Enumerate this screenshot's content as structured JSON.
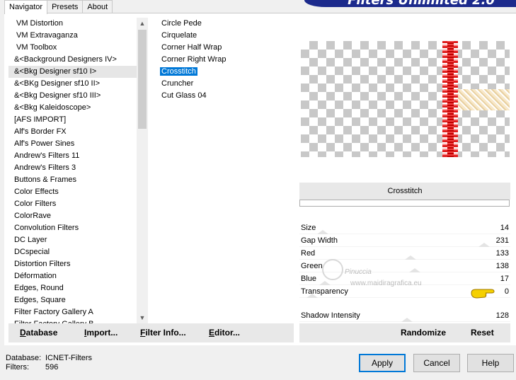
{
  "tabs": [
    {
      "label": "Navigator"
    },
    {
      "label": "Presets"
    },
    {
      "label": "About"
    }
  ],
  "title_banner": "Filters Unlimited 2.0",
  "categories": [
    "VM Distortion",
    "VM Extravaganza",
    "VM Toolbox",
    "&<Background Designers IV>",
    "&<Bkg Designer sf10 I>",
    "&<BKg Designer sf10 II>",
    "&<Bkg Designer sf10 III>",
    "&<Bkg Kaleidoscope>",
    "[AFS IMPORT]",
    "Alf's Border FX",
    "Alf's Power Sines",
    "Andrew's Filters 11",
    "Andrew's Filters 3",
    "Buttons & Frames",
    "Color Effects",
    "Color Filters",
    "ColorRave",
    "Convolution Filters",
    "DC Layer",
    "DCspecial",
    "Distortion Filters",
    "Déformation",
    "Edges, Round",
    "Edges, Square",
    "Filter Factory Gallery A",
    "Filter Factory Gallery B"
  ],
  "selected_category_index": 4,
  "filters": [
    "Circle Pede",
    "Cirquelate",
    "Corner Half Wrap",
    "Corner Right Wrap",
    "Crosstitch",
    "Cruncher",
    "Cut Glass 04"
  ],
  "selected_filter_index": 4,
  "filter_name": "Crosstitch",
  "params": [
    {
      "label": "Size",
      "value": "14",
      "level": 0.055
    },
    {
      "label": "Gap Width",
      "value": "231",
      "level": 0.906
    },
    {
      "label": "Red",
      "value": "133",
      "level": 0.52
    },
    {
      "label": "Green",
      "value": "138",
      "level": 0.54
    },
    {
      "label": "Blue",
      "value": "17",
      "level": 0.066
    },
    {
      "label": "Transparency",
      "value": "0",
      "level": 0
    }
  ],
  "shadow": {
    "label": "Shadow Intensity",
    "value": "128",
    "level": 0.5
  },
  "watermark": {
    "line1": "Pinuccia",
    "line2": "www.maidiragrafica.eu"
  },
  "actions_left": [
    {
      "label": "Database",
      "ul": "D"
    },
    {
      "label": "Import...",
      "ul": "I"
    },
    {
      "label": "Filter Info...",
      "ul": "F"
    },
    {
      "label": "Editor...",
      "ul": "E"
    }
  ],
  "actions_right": [
    {
      "label": "Randomize"
    },
    {
      "label": "Reset"
    }
  ],
  "footer": {
    "db_label": "Database:",
    "db_value": "ICNET-Filters",
    "filters_label": "Filters:",
    "filters_value": "596"
  },
  "buttons": {
    "apply": "Apply",
    "cancel": "Cancel",
    "help": "Help"
  }
}
